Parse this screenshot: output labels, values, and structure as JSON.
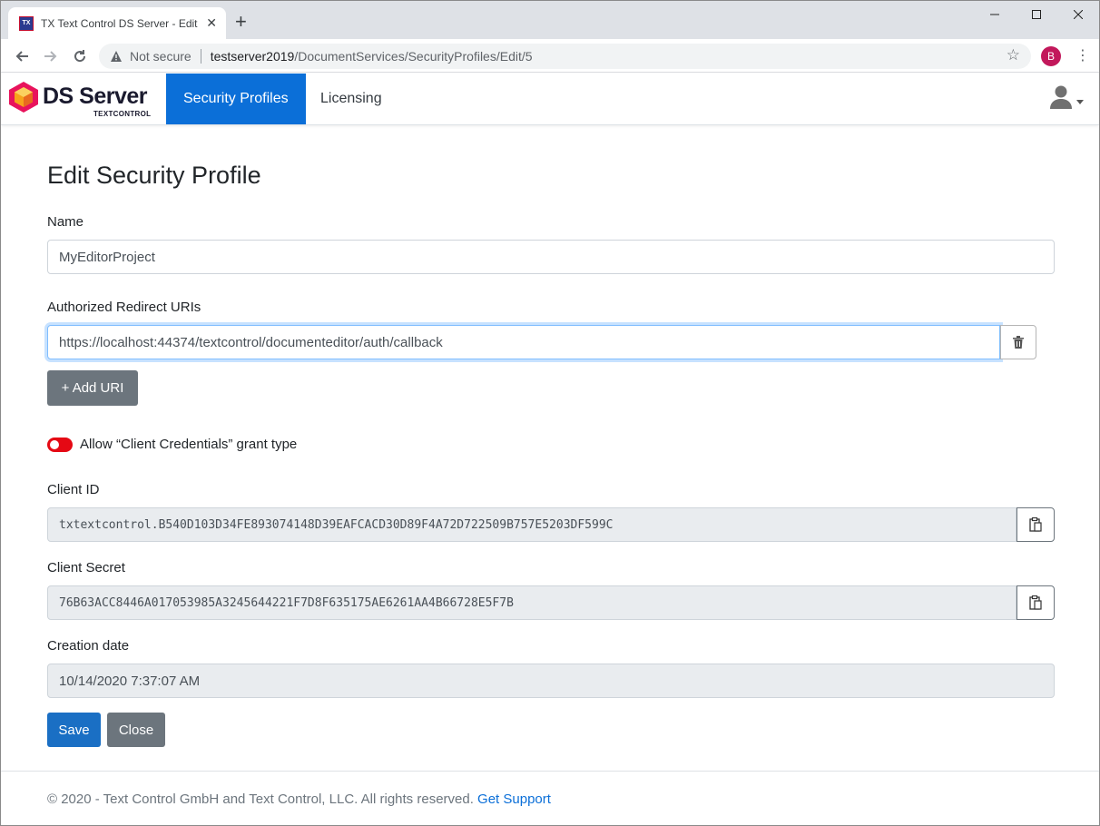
{
  "browser": {
    "tab_title": "TX Text Control DS Server - Edit S",
    "favicon_text": "TX",
    "not_secure": "Not secure",
    "url_host": "testserver2019",
    "url_path": "/DocumentServices/SecurityProfiles/Edit/5",
    "profile_initial": "B"
  },
  "navbar": {
    "brand": "DS Server",
    "brand_sub": "TEXTCONTROL",
    "items": [
      {
        "label": "Security Profiles",
        "active": true
      },
      {
        "label": "Licensing",
        "active": false
      }
    ]
  },
  "form": {
    "title": "Edit Security Profile",
    "name_label": "Name",
    "name_value": "MyEditorProject",
    "redirect_label": "Authorized Redirect URIs",
    "redirect_value": "https://localhost:44374/textcontrol/documenteditor/auth/callback",
    "add_uri_label": "+ Add URI",
    "toggle_label": "Allow “Client Credentials” grant type",
    "client_id_label": "Client ID",
    "client_id_value": "txtextcontrol.B540D103D34FE893074148D39EAFCACD30D89F4A72D722509B757E5203DF599C",
    "client_secret_label": "Client Secret",
    "client_secret_value": "76B63ACC8446A017053985A3245644221F7D8F635175AE6261AA4B66728E5F7B",
    "creation_label": "Creation date",
    "creation_value": "10/14/2020 7:37:07 AM",
    "save_label": "Save",
    "close_label": "Close"
  },
  "footer": {
    "text": "© 2020 - Text Control GmbH and Text Control, LLC. All rights reserved. ",
    "link": "Get Support"
  },
  "colors": {
    "primary": "#0b6fd8",
    "toggle_off": "#e50914",
    "secondary": "#6c757d"
  }
}
